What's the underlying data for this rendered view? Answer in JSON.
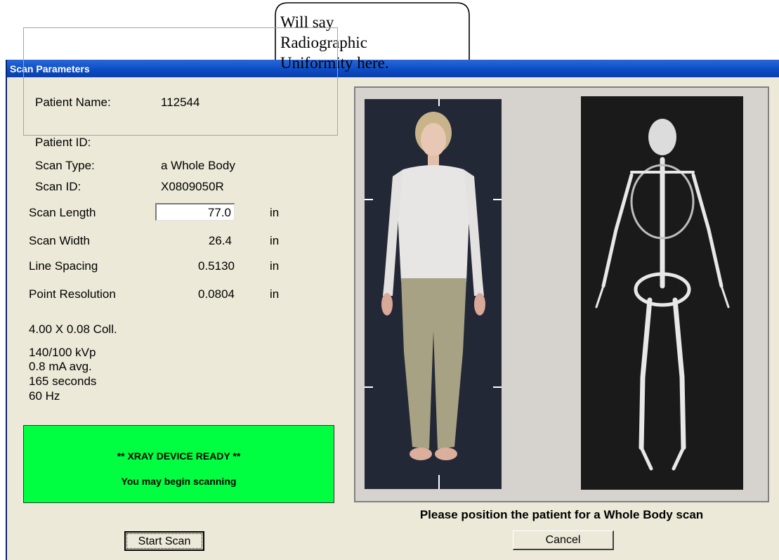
{
  "window": {
    "title": "Scan Parameters"
  },
  "callout": {
    "lines": [
      "Will say",
      "Radiographic",
      "Uniformity here."
    ]
  },
  "patient": {
    "name_label": "Patient Name:",
    "name_value": "112544",
    "id_label": "Patient ID:",
    "id_value": "",
    "scan_type_label": "Scan Type:",
    "scan_type_value": "a Whole Body",
    "scan_id_label": "Scan ID:",
    "scan_id_value": "X0809050R"
  },
  "params": {
    "scan_length": {
      "label": "Scan Length",
      "value": "77.0",
      "unit": "in"
    },
    "scan_width": {
      "label": "Scan Width",
      "value": "26.4",
      "unit": "in"
    },
    "line_spacing": {
      "label": "Line Spacing",
      "value": "0.5130",
      "unit": "in"
    },
    "point_resolution": {
      "label": "Point Resolution",
      "value": "0.0804",
      "unit": "in"
    }
  },
  "technique": {
    "collimation": "4.00 X 0.08 Coll.",
    "kvp": "140/100 kVp",
    "ma": "0.8 mA avg.",
    "seconds": "165 seconds",
    "hz": "60 Hz"
  },
  "status": {
    "line1": "** XRAY DEVICE READY **",
    "line2": "You may begin scanning",
    "color": "#00ff41"
  },
  "caption": "Please position the patient for a Whole Body scan",
  "buttons": {
    "start": "Start Scan",
    "cancel": "Cancel"
  }
}
